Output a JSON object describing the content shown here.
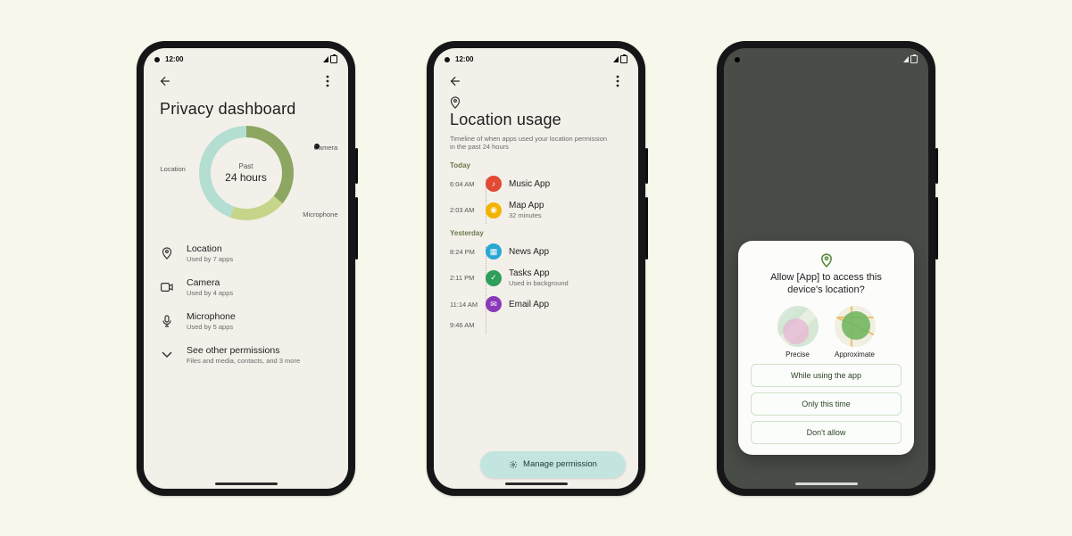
{
  "status": {
    "time": "12:00"
  },
  "phone1": {
    "title": "Privacy dashboard",
    "donut": {
      "center_top": "Past",
      "center_bottom": "24 hours",
      "labels": {
        "location": "Location",
        "camera": "Camera",
        "microphone": "Microphone"
      }
    },
    "rows": [
      {
        "icon": "location-icon",
        "title": "Location",
        "sub": "Used by 7 apps"
      },
      {
        "icon": "camera-icon",
        "title": "Camera",
        "sub": "Used by 4 apps"
      },
      {
        "icon": "microphone-icon",
        "title": "Microphone",
        "sub": "Used by 5 apps"
      },
      {
        "icon": "chevron-down-icon",
        "title": "See other permissions",
        "sub": "Files and media, contacts, and 3 more"
      }
    ]
  },
  "phone2": {
    "title": "Location usage",
    "subtitle": "Timeline of when apps used your location permission in the past 24 hours",
    "sections": {
      "today": {
        "label": "Today",
        "items": [
          {
            "time": "6:04 AM",
            "color": "#e24a33",
            "title": "Music App",
            "sub": ""
          },
          {
            "time": "2:03 AM",
            "color": "#f3b300",
            "title": "Map App",
            "sub": "32 minutes"
          }
        ]
      },
      "yesterday": {
        "label": "Yesterday",
        "items": [
          {
            "time": "8:24 PM",
            "color": "#2aa7d2",
            "title": "News App",
            "sub": ""
          },
          {
            "time": "2:11 PM",
            "color": "#2e9e5b",
            "title": "Tasks App",
            "sub": "Used in background"
          },
          {
            "time": "11:14 AM",
            "color": "#8a3ab9",
            "title": "Email App",
            "sub": ""
          },
          {
            "time": "9:46 AM",
            "color": "",
            "title": "",
            "sub": ""
          }
        ]
      }
    },
    "manage_label": "Manage permission"
  },
  "phone3": {
    "dialog": {
      "title": "Allow [App] to access this device's location?",
      "precise_label": "Precise",
      "approx_label": "Approximate",
      "buttons": [
        "While using the app",
        "Only this time",
        "Don't allow"
      ]
    }
  },
  "chart_data": {
    "type": "pie",
    "title": "Past 24 hours",
    "series": [
      {
        "name": "Camera",
        "value": 36
      },
      {
        "name": "Microphone",
        "value": 19
      },
      {
        "name": "Location",
        "value": 45
      }
    ]
  }
}
